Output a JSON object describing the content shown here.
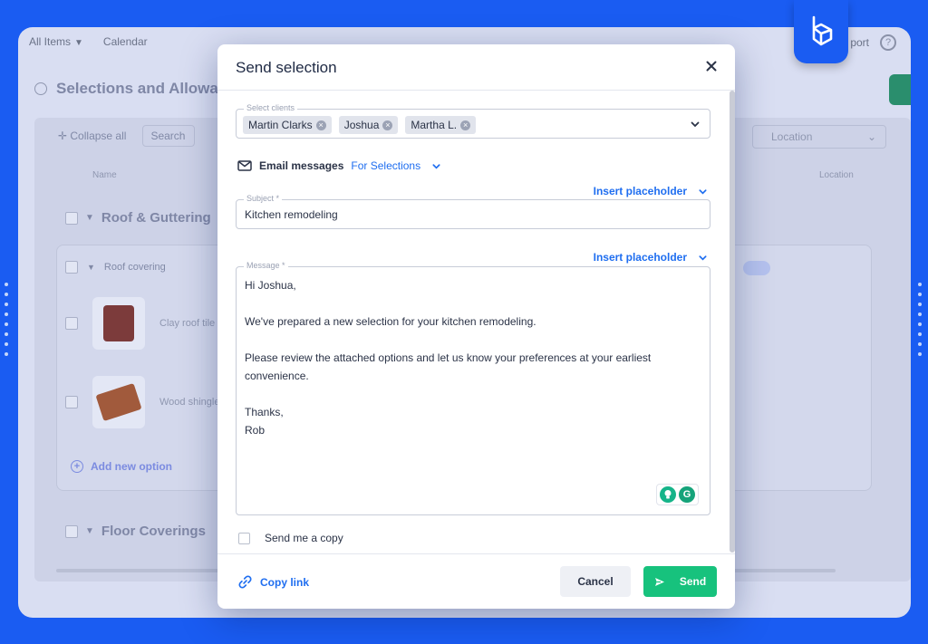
{
  "background_app": {
    "topbar": {
      "all_items": "All Items",
      "calendar": "Calendar",
      "support": "port",
      "help": "?"
    },
    "page_title": "Selections and Allowanc",
    "toolbar": {
      "collapse_all": "Collapse all",
      "search_placeholder": "Search"
    },
    "location_filter": "Location",
    "columns": {
      "name": "Name",
      "location": "Location"
    },
    "groups": [
      {
        "label": "Roof & Guttering"
      },
      {
        "label": "Floor Coverings"
      }
    ],
    "subgroup": "Roof covering",
    "items": [
      {
        "label": "Clay roof tile"
      },
      {
        "label": "Wood shingle"
      }
    ],
    "add_option": "Add new option"
  },
  "modal": {
    "title": "Send selection",
    "clients": {
      "label": "Select clients",
      "chips": [
        "Martin Clarks",
        "Joshua",
        "Martha L."
      ]
    },
    "email": {
      "label": "Email messages",
      "template": "For Selections"
    },
    "insert_placeholder": "Insert placeholder",
    "subject": {
      "label": "Subject *",
      "value": "Kitchen remodeling"
    },
    "message": {
      "label": "Message *",
      "lines": [
        "Hi Joshua,",
        "",
        "We've prepared a new selection for your kitchen remodeling.",
        "",
        "Please review the attached options and let us know your preferences at your earliest",
        "convenience.",
        "",
        "Thanks,",
        "Rob"
      ]
    },
    "send_copy": "Send me a copy",
    "footer": {
      "copy_link": "Copy link",
      "cancel": "Cancel",
      "send": "Send"
    }
  },
  "colors": {
    "background": "#1a5cf2",
    "accent_blue": "#1f6ef0",
    "send_green": "#17c27d",
    "chip_bg": "#e1e4ec"
  }
}
